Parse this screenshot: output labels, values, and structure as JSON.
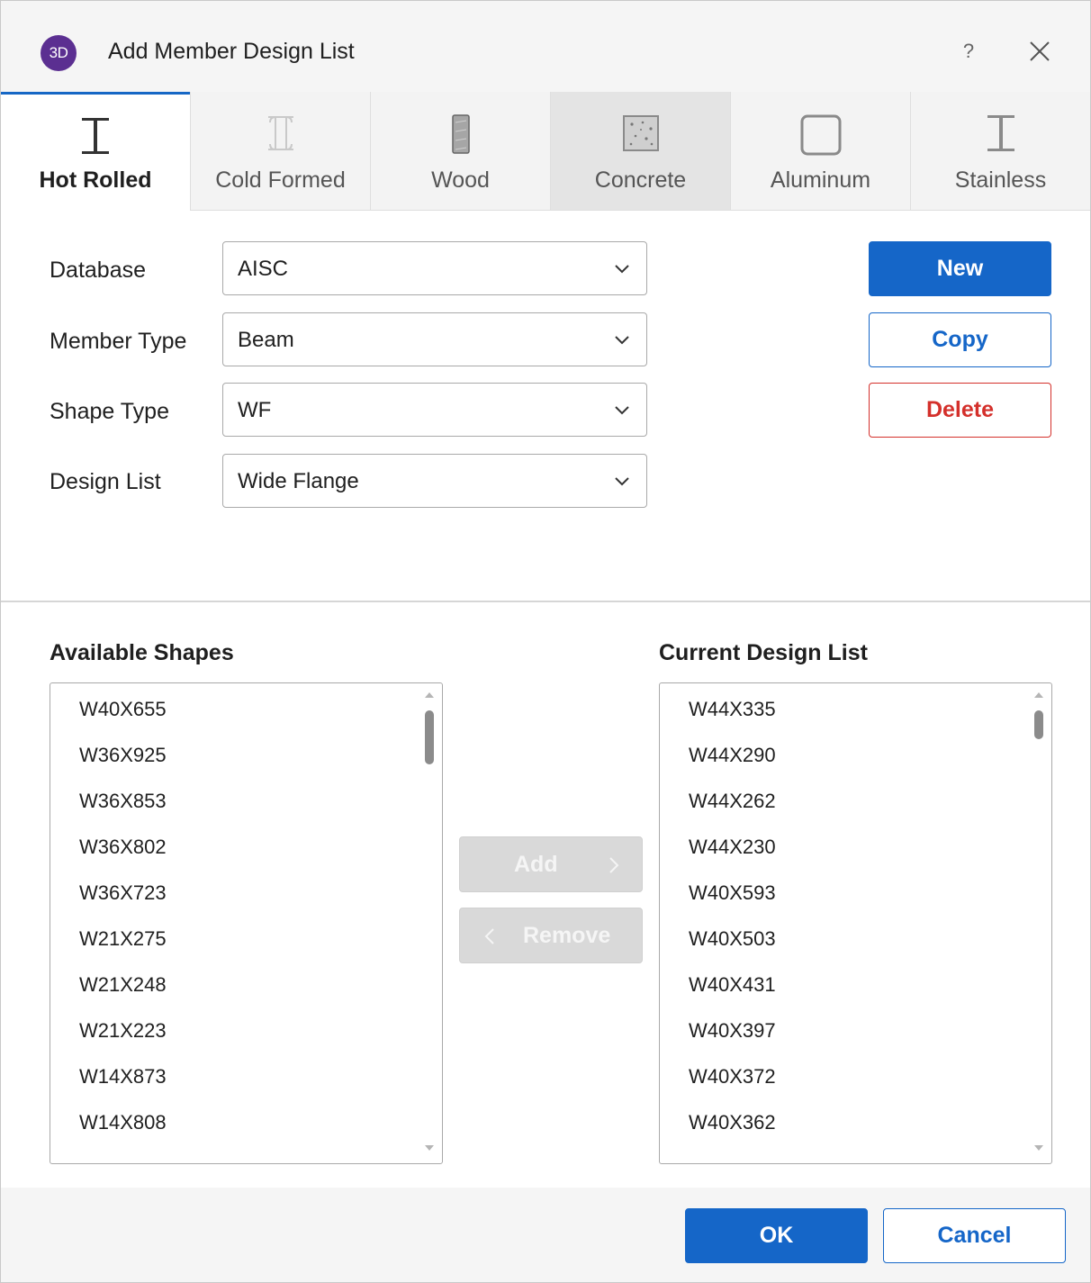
{
  "window": {
    "app_badge": "3D",
    "title": "Add Member Design List",
    "help": "?",
    "icons": {
      "close": "close-icon",
      "help": "help-icon"
    }
  },
  "tabs": [
    {
      "label": "Hot Rolled",
      "icon": "i-beam-icon",
      "active": true
    },
    {
      "label": "Cold Formed",
      "icon": "c-channel-icon",
      "active": false
    },
    {
      "label": "Wood",
      "icon": "wood-plank-icon",
      "active": false
    },
    {
      "label": "Concrete",
      "icon": "concrete-block-icon",
      "active": false
    },
    {
      "label": "Aluminum",
      "icon": "hollow-rect-icon",
      "active": false
    },
    {
      "label": "Stainless",
      "icon": "i-beam-outline-icon",
      "active": false
    }
  ],
  "form": {
    "database": {
      "label": "Database",
      "value": "AISC"
    },
    "member_type": {
      "label": "Member Type",
      "value": "Beam"
    },
    "shape_type": {
      "label": "Shape Type",
      "value": "WF"
    },
    "design_list": {
      "label": "Design List",
      "value": "Wide Flange"
    }
  },
  "actions": {
    "new": "New",
    "copy": "Copy",
    "delete": "Delete"
  },
  "available": {
    "title": "Available Shapes",
    "items": [
      "W40X655",
      "W36X925",
      "W36X853",
      "W36X802",
      "W36X723",
      "W21X275",
      "W21X248",
      "W21X223",
      "W14X873",
      "W14X808"
    ]
  },
  "current": {
    "title": "Current Design List",
    "items": [
      "W44X335",
      "W44X290",
      "W44X262",
      "W44X230",
      "W40X593",
      "W40X503",
      "W40X431",
      "W40X397",
      "W40X372",
      "W40X362"
    ]
  },
  "transfer": {
    "add": "Add",
    "remove": "Remove"
  },
  "footer": {
    "ok": "OK",
    "cancel": "Cancel"
  },
  "colors": {
    "accent": "#1566c8",
    "danger": "#d4302b",
    "badge": "#5b2f91"
  }
}
